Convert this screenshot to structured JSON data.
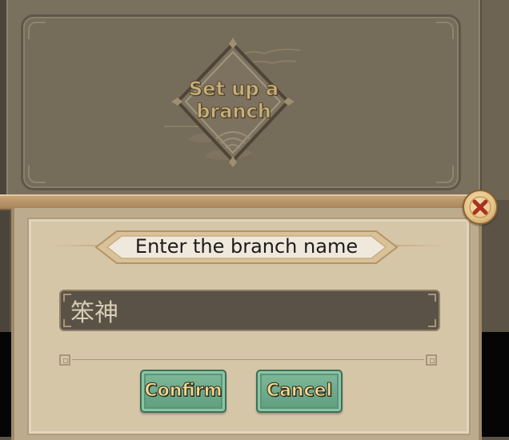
{
  "background": {
    "emblem_label": "Set up a branch"
  },
  "dialog": {
    "title": "Enter the branch name",
    "name_value": "笨神",
    "close_icon": "close-x-icon",
    "buttons": {
      "confirm_label": "Confirm",
      "cancel_label": "Cancel"
    }
  },
  "colors": {
    "accent_button": "#6aa98a",
    "button_text": "#f0d98e",
    "close_x": "#a8331f",
    "dialog_bg": "#d5c6a8",
    "input_bg": "#5b5247"
  }
}
